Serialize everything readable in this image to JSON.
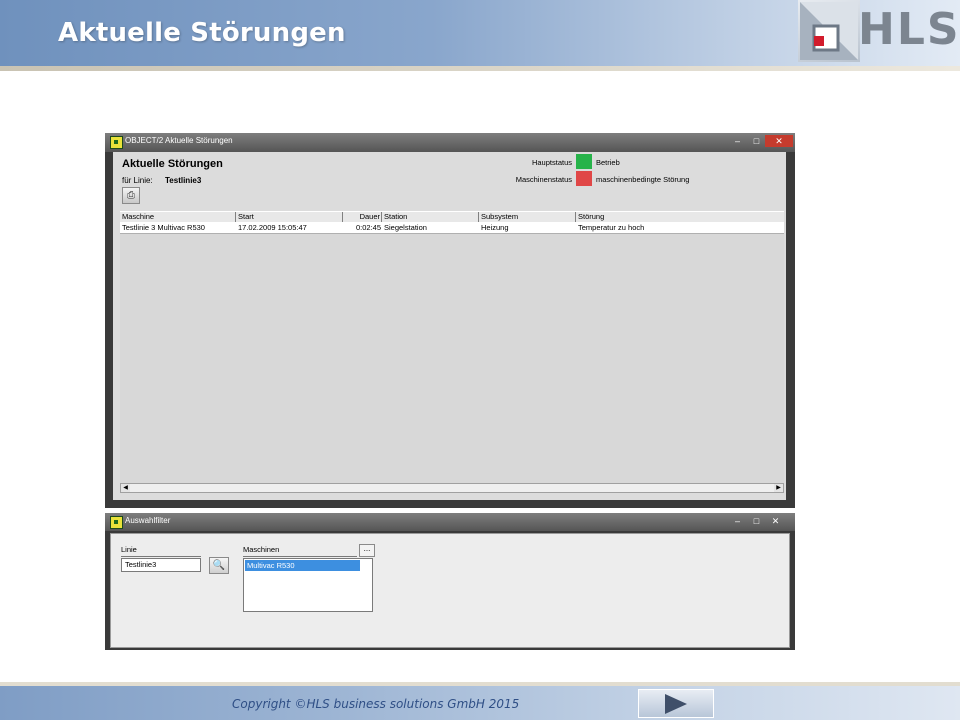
{
  "slide": {
    "title": "Aktuelle Störungen",
    "logo_text": "HLS",
    "copyright": "Copyright ©HLS business solutions GmbH 2015",
    "colors": {
      "header": "#7f9dc5",
      "logo_red": "#d21c2c"
    }
  },
  "main_window": {
    "title": "OBJECT/2 Aktuelle Störungen",
    "form_title": "Aktuelle Störungen",
    "line_label": "für Linie:",
    "line_value": "Testlinie3",
    "status": [
      {
        "label": "Hauptstatus",
        "value": "Betrieb",
        "color": "#27b34a"
      },
      {
        "label": "Maschinenstatus",
        "value": "maschinenbedingte Störung",
        "color": "#e04747"
      }
    ],
    "columns": [
      "Maschine",
      "Start",
      "Dauer",
      "Station",
      "Subsystem",
      "Störung"
    ],
    "rows": [
      [
        "Testlinie 3 Multivac R530",
        "17.02.2009 15:05:47",
        "0:02:45",
        "Siegelstation",
        "Heizung",
        "Temperatur zu hoch"
      ]
    ]
  },
  "filter_window": {
    "title": "Auswahlfilter",
    "line_label": "Linie",
    "line_value": "Testlinie3",
    "machines_label": "Maschinen",
    "machines_button": "...",
    "machines": [
      "Multivac R530"
    ]
  },
  "icons": [
    "app-icon",
    "minimize-icon",
    "maximize-icon",
    "close-icon",
    "printer-icon",
    "search-icon",
    "next-arrow-icon"
  ]
}
